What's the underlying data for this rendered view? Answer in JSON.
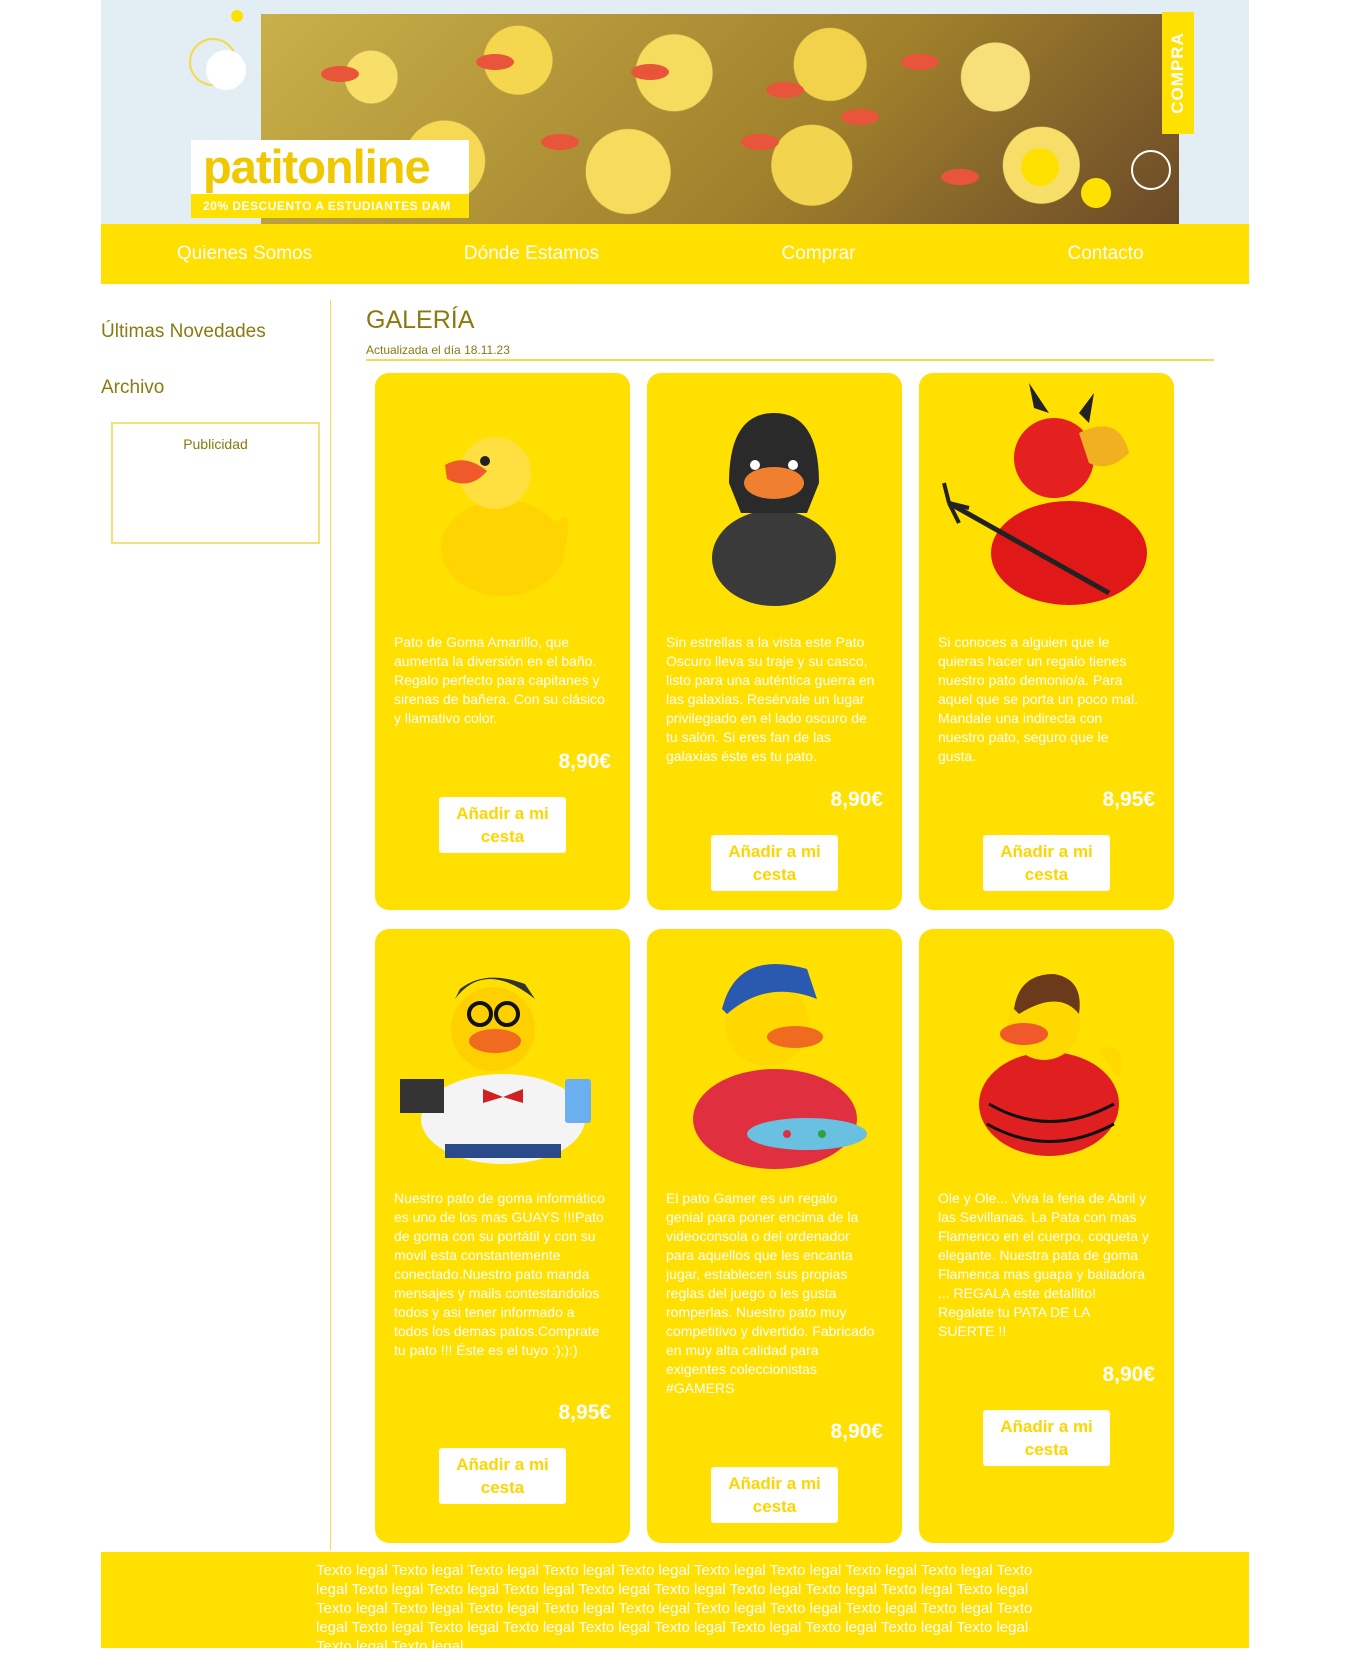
{
  "banner": {
    "logo": "patitonline",
    "tagline": "20% DESCUENTO A ESTUDIANTES DAM",
    "side_tag": "COMPRA"
  },
  "nav": [
    "Quienes Somos",
    "Dónde Estamos",
    "Comprar",
    "Contacto"
  ],
  "sidebar": {
    "links": [
      "Últimas Novedades",
      "Archivo"
    ],
    "ad_label": "Publicidad"
  },
  "main": {
    "title": "GALERÍA",
    "updated": "Actualizada el día 18.11.23"
  },
  "products": [
    {
      "icon": "yellow-duck-icon",
      "description": "Pato de Goma Amarillo, que aumenta la diversión en el baño. Regalo perfecto para capitanes y sirenas de bañera. Con su clásico y llamativo color.",
      "price": "8,90€",
      "button": "Añadir a mi cesta"
    },
    {
      "icon": "dark-vader-duck-icon",
      "description": "Sin estrellas a la vista este Pato Oscuro lleva su traje y su casco, listo para una auténtica guerra en las galaxias. Resérvale un lugar privilegiado en el lado oscuro de tu salón. Si eres fan de las galaxias éste es tu pato.",
      "price": "8,90€",
      "button": "Añadir a mi cesta"
    },
    {
      "icon": "devil-duck-icon",
      "description": "Si conoces a alguien que le quieras hacer un regalo tienes nuestro pato demonio/a. Para aquel que se porta un poco mal. Mandale una indirecta con nuestro pato, seguro que le gusta.",
      "price": "8,95€",
      "button": "Añadir a mi cesta"
    },
    {
      "icon": "geek-duck-icon",
      "description": "Nuestro pato de goma informático es uno de los mas GUAYS !!!Pato de goma con su portátil y con su movil esta constantemente conectado.Nuestro pato manda mensajes y mails contestandolos todos y asi tener informado a todos los demas patos.Comprate tu pato !!! Éste es el tuyo :);):)",
      "price": "8,95€",
      "button": "Añadir a mi cesta"
    },
    {
      "icon": "gamer-duck-icon",
      "description": "El pato Gamer es un regalo genial para poner encima de la videoconsola o del ordenador para aquellos que les encanta jugar, establecen sus propias reglas del juego o les gusta romperlas. Nuestro pato muy competitivo y divertido. Fabricado en muy alta calidad para exigentes coleccionistas #GAMERS",
      "price": "8,90€",
      "button": "Añadir a mi cesta"
    },
    {
      "icon": "flamenco-duck-icon",
      "description": "Ole y Ole... Viva la feria de Abril y las Sevillanas. La Pata con mas Flamenco en el cuerpo, coqueta y elegante. Nuestra pata de goma Flamenca mas guapa y bailadora ... REGALA este detallito! Regalate tu PATA DE LA SUERTE !!",
      "price": "8,90€",
      "button": "Añadir a mi cesta"
    }
  ],
  "footer": {
    "text": "Texto legal Texto legal Texto legal Texto legal Texto legal Texto legal Texto legal Texto legal Texto legal Texto legal Texto legal Texto legal Texto legal Texto legal Texto legal Texto legal Texto legal Texto legal Texto legal Texto legal Texto legal Texto legal Texto legal Texto legal Texto legal Texto legal Texto legal Texto legal Texto legal Texto legal Texto legal Texto legal Texto legal Texto legal Texto legal Texto legal Texto legal Texto legal Texto legal Texto legal"
  },
  "colors": {
    "brand_yellow": "#ffe000",
    "text_olive": "#8a7a10"
  }
}
